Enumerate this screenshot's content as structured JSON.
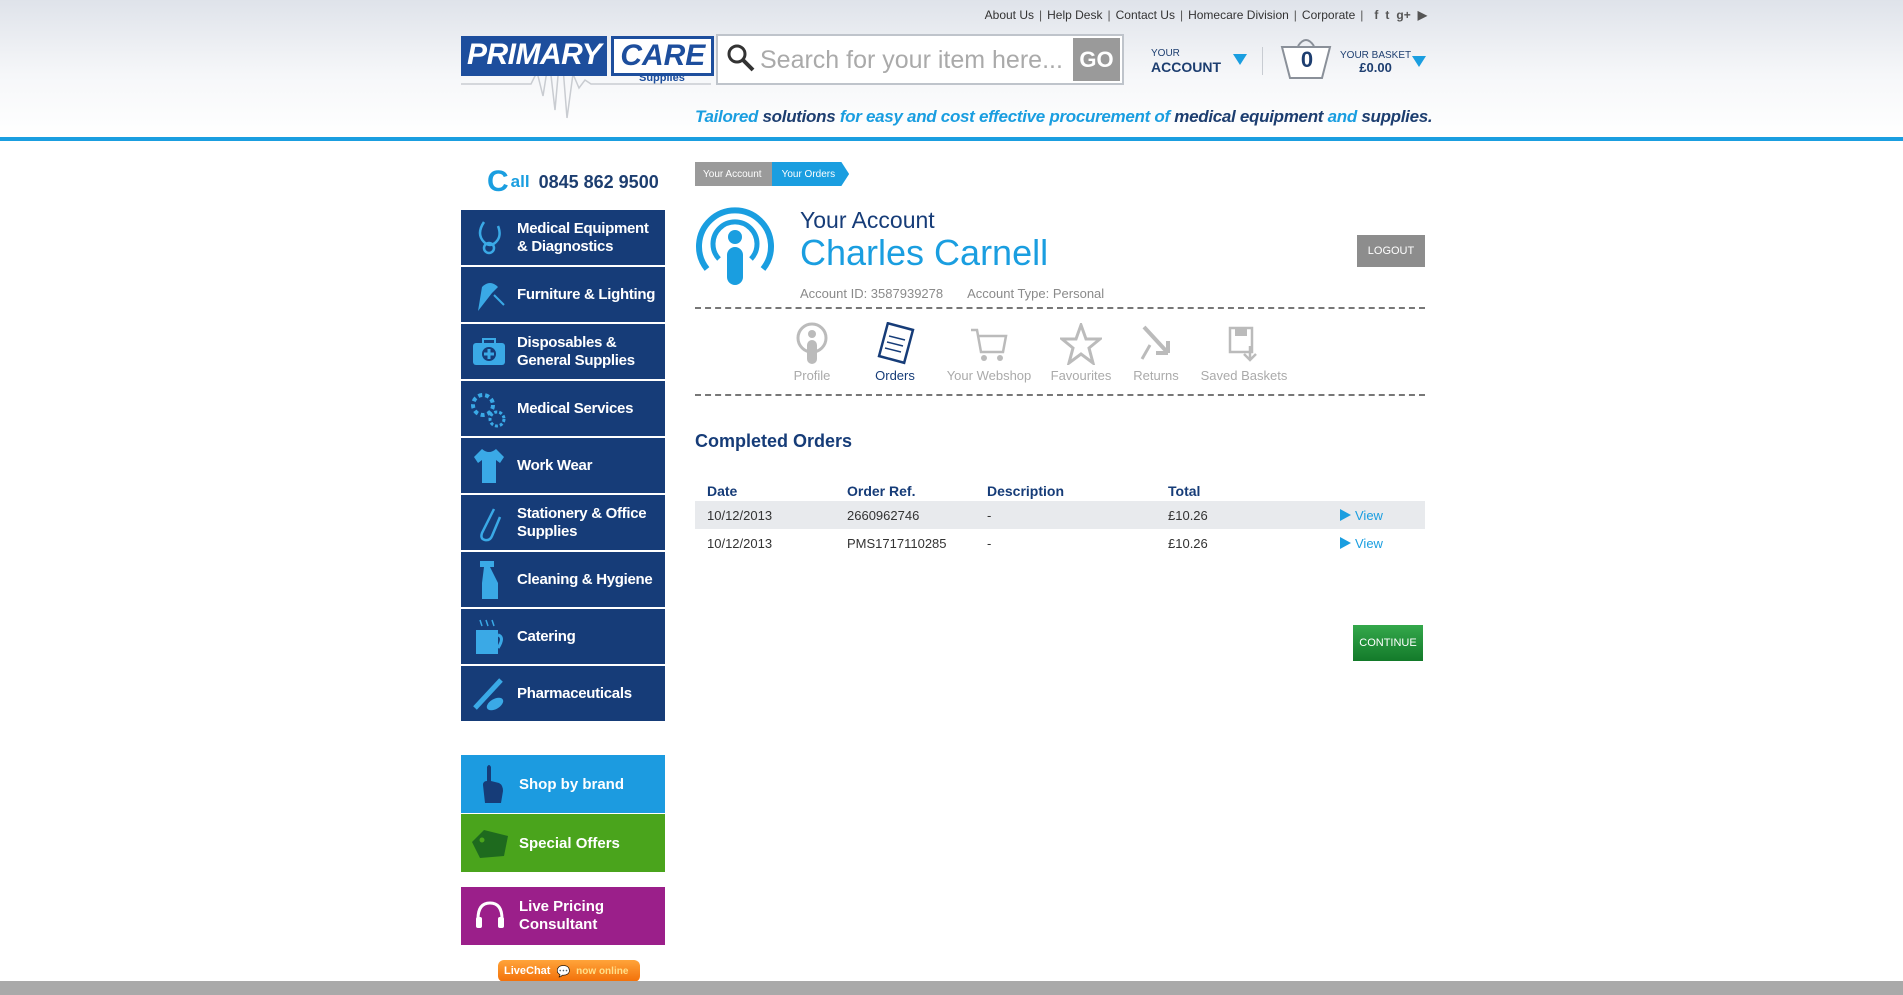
{
  "header": {
    "toplinks": [
      "About Us",
      "Help Desk",
      "Contact Us",
      "Homecare Division",
      "Corporate"
    ],
    "social": [
      "facebook-icon",
      "twitter-icon",
      "google-plus-icon",
      "youtube-icon"
    ],
    "logo": {
      "primary": "PRIMARY",
      "care": "CARE",
      "sub": "Supplies"
    },
    "search": {
      "placeholder": "Search for your item here...",
      "go_label": "GO"
    },
    "account": {
      "line1": "YOUR",
      "line2": "ACCOUNT"
    },
    "basket": {
      "count": "0",
      "label": "YOUR BASKET",
      "total": "£0.00"
    },
    "tagline": {
      "p1": "Tailored ",
      "p2": "solutions",
      "p3": " for easy and cost effective  procurement of ",
      "p4": "medical equipment",
      "p5": " and ",
      "p6": "supplies."
    }
  },
  "sidebar": {
    "phone": {
      "c": "C",
      "all": "all",
      "number": "0845 862 9500"
    },
    "items": [
      {
        "label": "Medical Equipment & Diagnostics",
        "icon": "stethoscope-icon"
      },
      {
        "label": "Furniture & Lighting",
        "icon": "lamp-icon"
      },
      {
        "label": "Disposables & General Supplies",
        "icon": "first-aid-icon"
      },
      {
        "label": "Medical Services",
        "icon": "gears-icon"
      },
      {
        "label": "Work Wear",
        "icon": "tunic-icon"
      },
      {
        "label": "Stationery & Office Supplies",
        "icon": "paperclip-icon"
      },
      {
        "label": "Cleaning & Hygiene",
        "icon": "spray-bottle-icon"
      },
      {
        "label": "Catering",
        "icon": "mug-icon"
      },
      {
        "label": "Pharmaceuticals",
        "icon": "syringe-icon"
      }
    ],
    "shop_by_brand": "Shop by brand",
    "special_offers": "Special Offers",
    "live_pricing": "Live Pricing Consultant",
    "livechat": {
      "label": "LiveChat",
      "status": "now online"
    }
  },
  "main": {
    "breadcrumb": [
      "Your Account",
      "Your Orders"
    ],
    "account_label": "Your Account",
    "account_name": "Charles Carnell",
    "logout_label": "LOGOUT",
    "account_id": "Account ID: 3587939278",
    "account_type": "Account Type: Personal",
    "tabs": [
      {
        "label": "Profile",
        "icon": "profile-icon"
      },
      {
        "label": "Orders",
        "icon": "orders-icon"
      },
      {
        "label": "Your Webshop",
        "icon": "cart-icon"
      },
      {
        "label": "Favourites",
        "icon": "star-icon"
      },
      {
        "label": "Returns",
        "icon": "returns-icon"
      },
      {
        "label": "Saved Baskets",
        "icon": "saved-basket-icon"
      }
    ],
    "active_tab": "Orders",
    "section_title": "Completed Orders",
    "columns": [
      "Date",
      "Order Ref.",
      "Description",
      "Total",
      ""
    ],
    "orders": [
      {
        "date": "10/12/2013",
        "ref": "2660962746",
        "desc": "-",
        "total": "£10.26",
        "action": "View"
      },
      {
        "date": "10/12/2013",
        "ref": "PMS1717110285",
        "desc": "-",
        "total": "£10.26",
        "action": "View"
      }
    ],
    "continue_label": "CONTINUE"
  },
  "colors": {
    "brand_dark": "#163c78",
    "brand_blue": "#1a9ee0",
    "green": "#4aa41c",
    "purple": "#9b1f8a"
  }
}
